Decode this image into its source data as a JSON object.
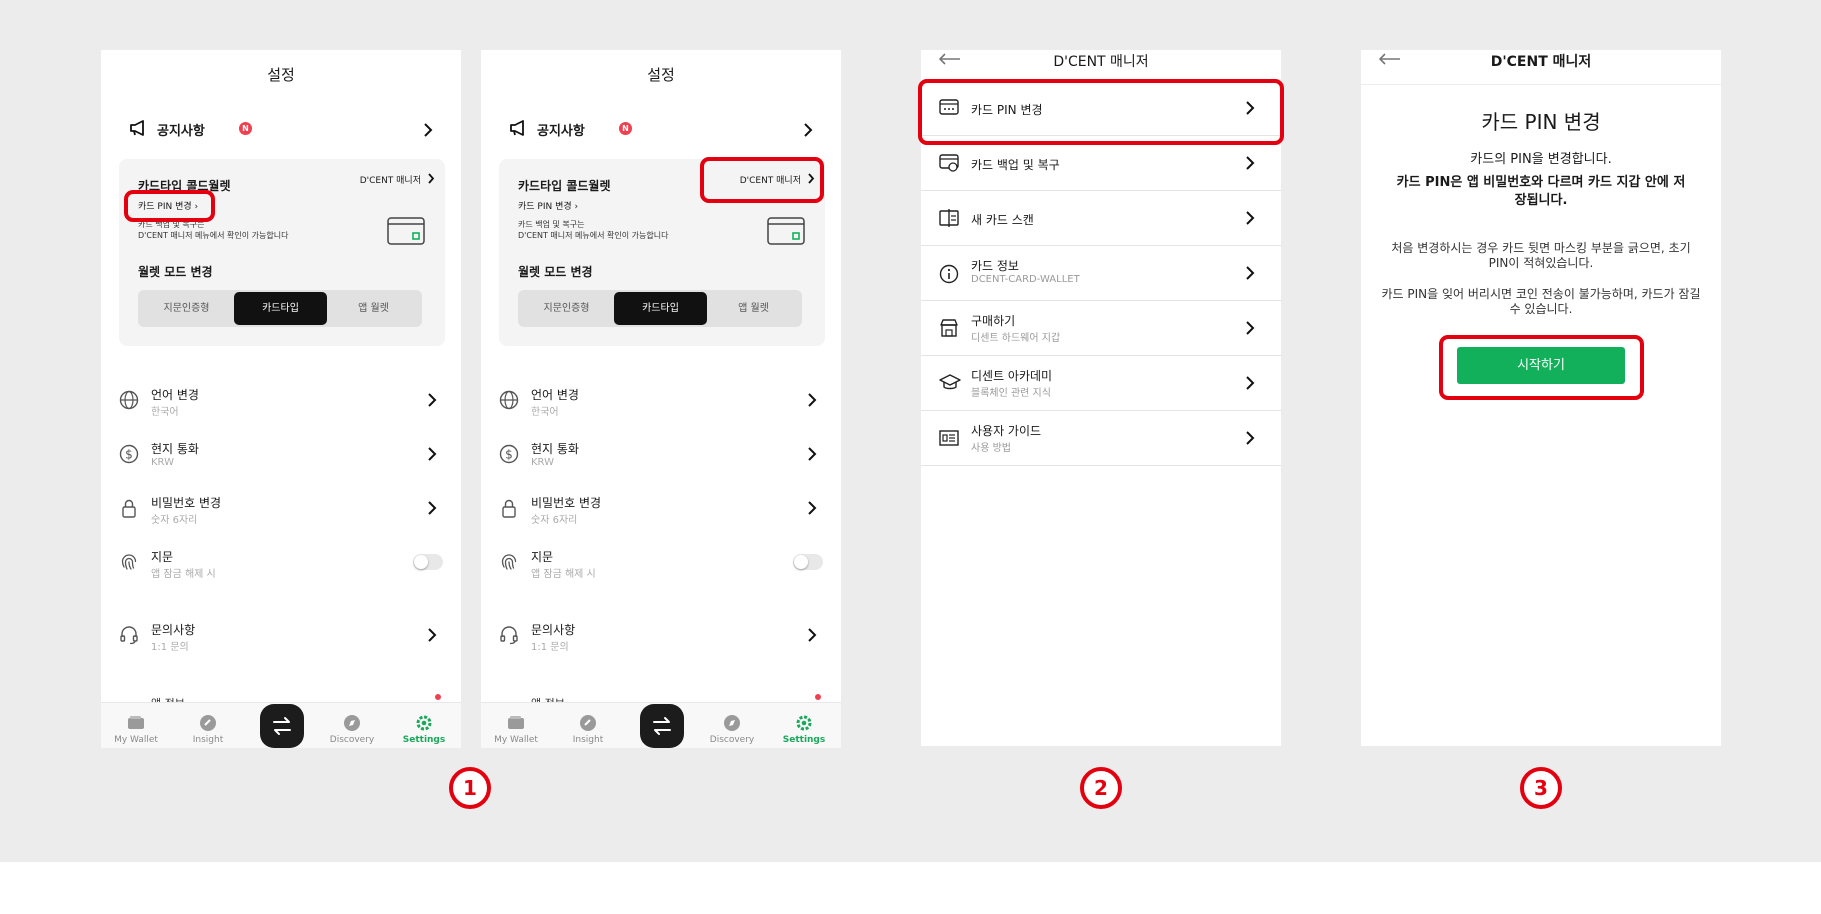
{
  "colors": {
    "accent_green": "#12b05a",
    "highlight_red": "#e3000f",
    "badge_red": "#ef4050"
  },
  "settings": {
    "title": "설정",
    "notice": {
      "label": "공지사항",
      "badge": "N"
    },
    "card": {
      "title": "카드타입 콜드월렛",
      "manager_link": "D'CENT 매니저",
      "pin_link": "카드 PIN 변경",
      "desc_line1": "카드 백업 및 복구는",
      "desc_line2": "D'CENT 매니저 메뉴에서 확인이 가능합니다",
      "mode_title": "월렛 모드 변경",
      "modes": [
        "지문인증형",
        "카드타입",
        "앱 월렛"
      ],
      "selected_mode": "카드타입"
    },
    "rows": [
      {
        "title": "언어 변경",
        "sub": "한국어",
        "icon": "globe-icon"
      },
      {
        "title": "현지 통화",
        "sub": "KRW",
        "icon": "dollar-icon"
      },
      {
        "title": "비밀번호 변경",
        "sub": "숫자 6자리",
        "icon": "lock-icon"
      },
      {
        "title": "지문",
        "sub": "앱 잠금 해제 시",
        "icon": "fingerprint-icon",
        "toggle": false
      },
      {
        "title": "문의사항",
        "sub": "1:1 문의",
        "icon": "headset-icon"
      }
    ],
    "cut_row": "앱 정보",
    "tabs": [
      "My Wallet",
      "Insight",
      "Discovery",
      "Settings"
    ],
    "active_tab": "Settings"
  },
  "manager": {
    "title": "D'CENT 매니저",
    "items": [
      {
        "title": "카드 PIN 변경",
        "sub": "",
        "icon": "card-pin-icon"
      },
      {
        "title": "카드 백업 및 복구",
        "sub": "",
        "icon": "card-backup-icon"
      },
      {
        "title": "새 카드 스캔",
        "sub": "",
        "icon": "card-scan-icon"
      },
      {
        "title": "카드 정보",
        "sub": "DCENT-CARD-WALLET",
        "icon": "info-icon"
      },
      {
        "title": "구매하기",
        "sub": "디센트 하드웨어 지갑",
        "icon": "store-icon"
      },
      {
        "title": "디센트 아카데미",
        "sub": "블록체인 관련 지식",
        "icon": "academy-icon"
      },
      {
        "title": "사용자 가이드",
        "sub": "사용 방법",
        "icon": "guide-icon"
      }
    ]
  },
  "pin_screen": {
    "title": "D'CENT 매니저",
    "heading": "카드 PIN 변경",
    "line1": "카드의 PIN을 변경합니다.",
    "line2": "카드 PIN은 앱 비밀번호와 다르며 카드 지갑 안에 저장됩니다.",
    "line3": "처음 변경하시는 경우 카드 뒷면 마스킹 부분을 긁으면, 초기 PIN이 적혀있습니다.",
    "line4": "카드 PIN을 잊어 버리시면 코인 전송이 불가능하며, 카드가 잠길 수 있습니다.",
    "button": "시작하기"
  },
  "steps": [
    "1",
    "2",
    "3"
  ]
}
